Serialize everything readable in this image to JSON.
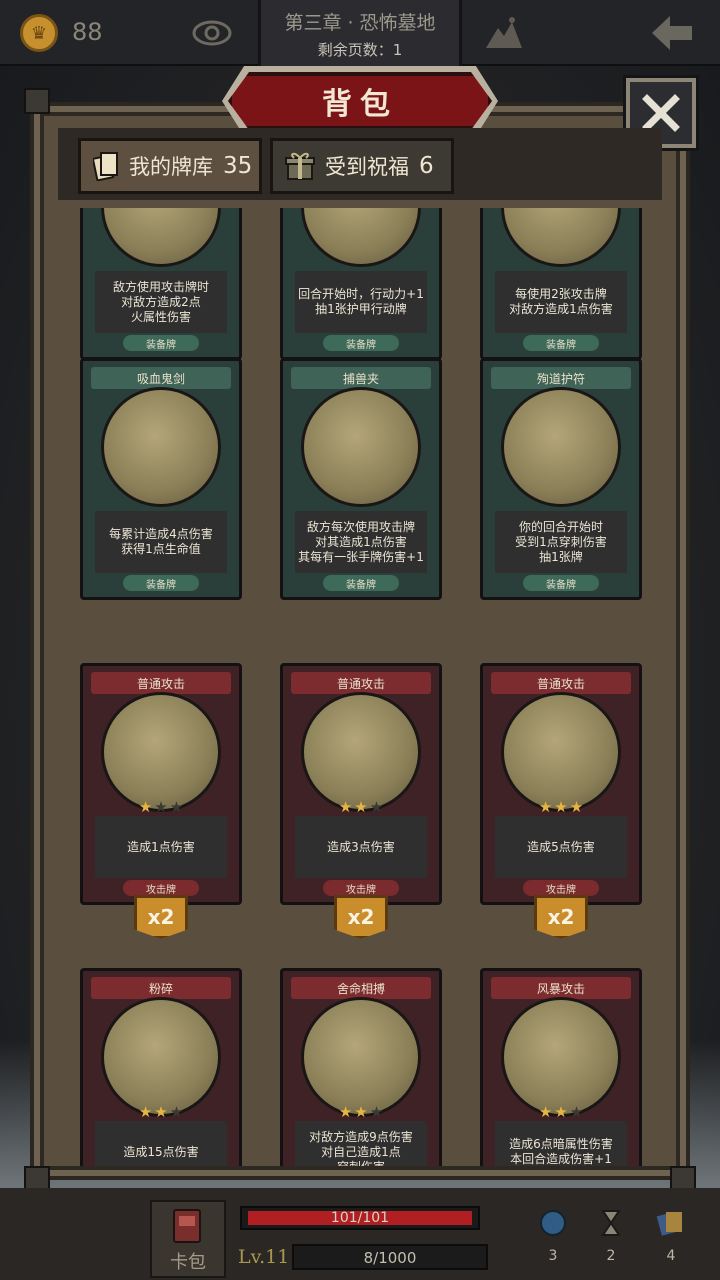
{
  "topbar": {
    "coins": "88",
    "chapter_title": "第三章 · 恐怖墓地",
    "pages_left": "剩余页数：1"
  },
  "panel": {
    "title": "背包",
    "tabs": [
      {
        "label": "我的牌库",
        "count": "35",
        "active": true
      },
      {
        "label": "受到祝福",
        "count": "6",
        "active": false
      }
    ]
  },
  "cards": [
    {
      "name": "",
      "desc": "敌方使用攻击牌时\n对敌方造成2点\n火属性伤害",
      "type": "装备牌",
      "kind": "equip"
    },
    {
      "name": "",
      "desc": "回合开始时，行动力+1\n抽1张护甲行动牌",
      "type": "装备牌",
      "kind": "equip"
    },
    {
      "name": "",
      "desc": "每使用2张攻击牌\n对敌方造成1点伤害",
      "type": "装备牌",
      "kind": "equip"
    },
    {
      "name": "吸血鬼剑",
      "desc": "每累计造成4点伤害\n获得1点生命值",
      "type": "装备牌",
      "kind": "equip"
    },
    {
      "name": "捕兽夹",
      "desc": "敌方每次使用攻击牌\n对其造成1点伤害\n其每有一张手牌伤害+1",
      "type": "装备牌",
      "kind": "equip"
    },
    {
      "name": "殉道护符",
      "desc": "你的回合开始时\n受到1点穿刺伤害\n抽1张牌",
      "type": "装备牌",
      "kind": "equip"
    },
    {
      "name": "普通攻击",
      "desc": "造成1点伤害",
      "type": "攻击牌",
      "kind": "attack",
      "stars": 1,
      "count": "x2"
    },
    {
      "name": "普通攻击",
      "desc": "造成3点伤害",
      "type": "攻击牌",
      "kind": "attack",
      "stars": 2,
      "count": "x2"
    },
    {
      "name": "普通攻击",
      "desc": "造成5点伤害",
      "type": "攻击牌",
      "kind": "attack",
      "stars": 3,
      "count": "x2"
    },
    {
      "name": "粉碎",
      "desc": "造成15点伤害",
      "type": "",
      "kind": "attack",
      "stars": 2
    },
    {
      "name": "舍命相搏",
      "desc": "对敌方造成9点伤害\n对自己造成1点\n穿刺伤害",
      "type": "",
      "kind": "attack",
      "stars": 2
    },
    {
      "name": "风暴攻击",
      "desc": "造成6点暗属性伤害\n本回合造成伤害+1",
      "type": "",
      "kind": "attack",
      "stars": 2
    }
  ],
  "bottom": {
    "deck_label": "卡包",
    "hp_text": "101/101",
    "hp_fraction": 1.0,
    "level": "Lv.11",
    "xp_text": "8/1000",
    "resources": [
      "3",
      "2",
      "4"
    ]
  },
  "colors": {
    "equip": "#2a3f39",
    "attack": "#3e2225",
    "gold": "#c98d2c",
    "hp": "#b11f22"
  }
}
